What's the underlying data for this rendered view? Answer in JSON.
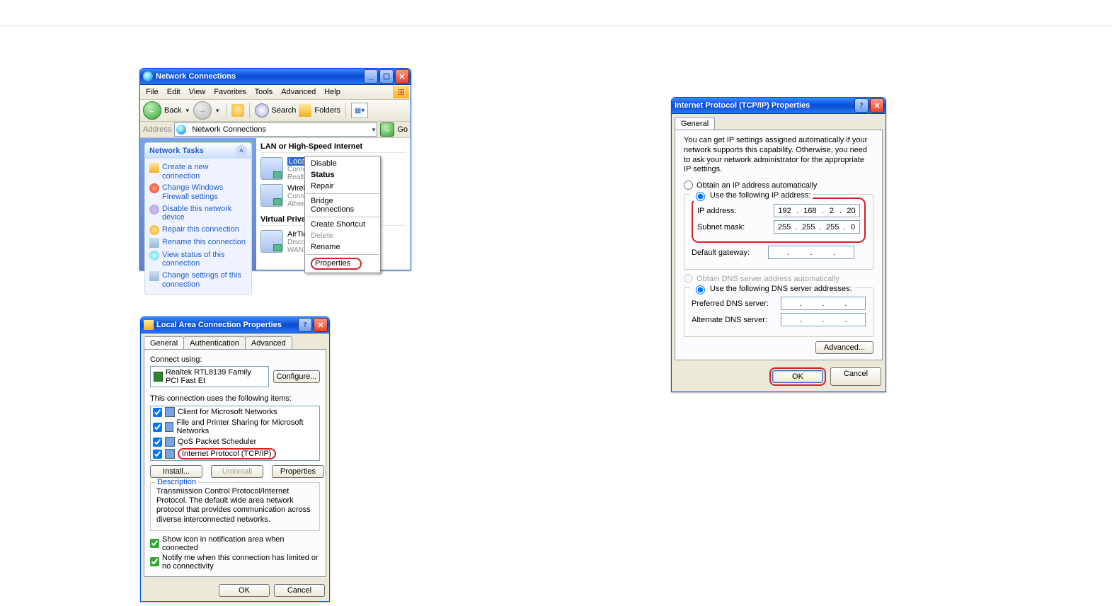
{
  "hr": true,
  "colors": {
    "xp_blue": "#0b4fd6",
    "accent_red": "#d4202a"
  },
  "nc": {
    "title": "Network Connections",
    "menu": [
      "File",
      "Edit",
      "View",
      "Favorites",
      "Tools",
      "Advanced",
      "Help"
    ],
    "toolbar": {
      "back": "Back",
      "search": "Search",
      "folders": "Folders"
    },
    "address": {
      "label": "Address",
      "value": "Network Connections",
      "go": "Go"
    },
    "tasks_title": "Network Tasks",
    "tasks": [
      "Create a new connection",
      "Change Windows Firewall settings",
      "Disable this network device",
      "Repair this connection",
      "Rename this connection",
      "View status of this connection",
      "Change settings of this connection"
    ],
    "cat1": "LAN or High-Speed Internet",
    "lac": {
      "name": "Local Area Connection",
      "l2": "Conne",
      "l3": "Realte"
    },
    "wlan": {
      "name": "Wireles",
      "l2": "Conne",
      "l3": "Athero"
    },
    "cat2": "Virtual Private N",
    "vpn": {
      "name": "AirTies",
      "l2": "Discon",
      "l3": "WAN Miniport (PPTP)"
    },
    "ctx": {
      "disable": "Disable",
      "status": "Status",
      "repair": "Repair",
      "bridge": "Bridge Connections",
      "shortcut": "Create Shortcut",
      "delete": "Delete",
      "rename": "Rename",
      "properties": "Properties"
    }
  },
  "lac": {
    "title": "Local Area Connection Properties",
    "tabs": [
      "General",
      "Authentication",
      "Advanced"
    ],
    "connect_using": "Connect using:",
    "adapter": "Realtek RTL8139 Family PCI Fast Et",
    "configure": "Configure...",
    "uses_label": "This connection uses the following items:",
    "items": [
      "Client for Microsoft Networks",
      "File and Printer Sharing for Microsoft Networks",
      "QoS Packet Scheduler",
      "Internet Protocol (TCP/IP)"
    ],
    "install": "Install...",
    "uninstall": "Uninstall",
    "properties": "Properties",
    "desc_title": "Description",
    "desc": "Transmission Control Protocol/Internet Protocol. The default wide area network protocol that provides communication across diverse interconnected networks.",
    "chk1": "Show icon in notification area when connected",
    "chk2": "Notify me when this connection has limited or no connectivity",
    "ok": "OK",
    "cancel": "Cancel"
  },
  "ip": {
    "title": "Internet Protocol (TCP/IP) Properties",
    "tab": "General",
    "intro": "You can get IP settings assigned automatically if your network supports this capability. Otherwise, you need to ask your network administrator for the appropriate IP settings.",
    "auto_ip": "Obtain an IP address automatically",
    "use_ip": "Use the following IP address:",
    "ip_label": "IP address:",
    "ip_value": [
      "192",
      "168",
      "2",
      "20"
    ],
    "mask_label": "Subnet mask:",
    "mask_value": [
      "255",
      "255",
      "255",
      "0"
    ],
    "gw_label": "Default gateway:",
    "gw_value": [
      "",
      "",
      "",
      ""
    ],
    "auto_dns": "Obtain DNS server address automatically",
    "use_dns": "Use the following DNS server addresses:",
    "pref_dns": "Preferred DNS server:",
    "alt_dns": "Alternate DNS server:",
    "advanced": "Advanced...",
    "ok": "OK",
    "cancel": "Cancel"
  }
}
